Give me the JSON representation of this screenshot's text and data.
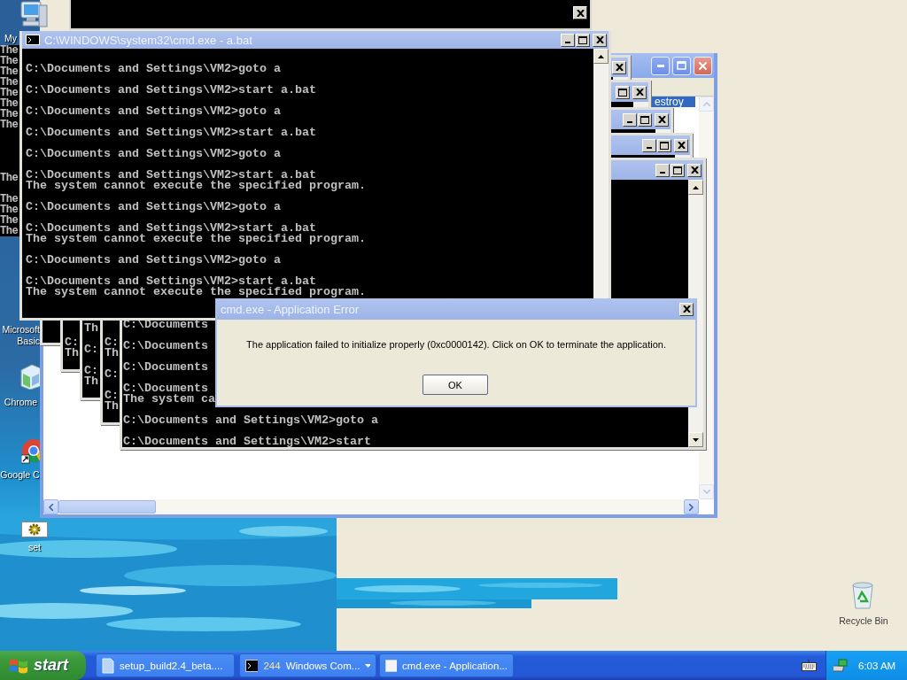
{
  "desktop_icons": [
    {
      "kind": "computer",
      "label": [
        "My"
      ]
    },
    {
      "kind": "hidden",
      "label": [
        "Microsoft",
        "Basic"
      ]
    },
    {
      "kind": "app",
      "label": [
        "Chrome"
      ]
    },
    {
      "kind": "browser",
      "label": [
        "Google C"
      ]
    },
    {
      "kind": "settings",
      "label": [
        "set"
      ]
    },
    {
      "kind": "recycle",
      "label": [
        "Recycle Bin"
      ]
    }
  ],
  "background_window": {
    "selected_item": "estroy"
  },
  "cascade_windows": [
    {
      "lines": [
        {
          "kind": "text",
          "text": "C:"
        },
        {
          "kind": "text",
          "text": "Th"
        },
        {
          "kind": "blank"
        }
      ]
    },
    {
      "lines": [
        {
          "kind": "text",
          "text": "Th"
        },
        {
          "kind": "blank"
        },
        {
          "kind": "text",
          "text": "C:"
        },
        {
          "kind": "blank"
        },
        {
          "kind": "text",
          "text": "C:"
        },
        {
          "kind": "text",
          "text": "Th"
        },
        {
          "kind": "blank"
        }
      ]
    },
    {
      "lines": [
        {
          "kind": "text",
          "text": "C:"
        },
        {
          "kind": "text",
          "text": "Th"
        },
        {
          "kind": "blank"
        },
        {
          "kind": "text",
          "text": "C:"
        },
        {
          "kind": "blank"
        },
        {
          "kind": "text",
          "text": "C:"
        },
        {
          "kind": "text",
          "text": "Th"
        },
        {
          "kind": "blank"
        }
      ]
    },
    {
      "lines": [
        {
          "kind": "text",
          "text": "C:\\Documents"
        },
        {
          "kind": "blank"
        },
        {
          "kind": "text",
          "text": "C:\\Documents"
        },
        {
          "kind": "blank"
        },
        {
          "kind": "text",
          "text": "C:\\Documents"
        },
        {
          "kind": "blank"
        },
        {
          "kind": "text",
          "text": "C:\\Documents"
        },
        {
          "kind": "text",
          "text": "The system ca"
        },
        {
          "kind": "blank"
        },
        {
          "kind": "text",
          "text": "C:\\Documents and Settings\\VM2>goto a"
        },
        {
          "kind": "blank"
        },
        {
          "kind": "text",
          "text": "C:\\Documents and Settings\\VM2>start"
        }
      ]
    }
  ],
  "left_console": {
    "lines": [
      {
        "kind": "text",
        "text": "The"
      },
      {
        "kind": "text",
        "text": "The"
      },
      {
        "kind": "text",
        "text": "The"
      },
      {
        "kind": "text",
        "text": "The"
      },
      {
        "kind": "text",
        "text": "The"
      },
      {
        "kind": "text",
        "text": "The"
      },
      {
        "kind": "text",
        "text": "The"
      },
      {
        "kind": "text",
        "text": "The"
      },
      {
        "kind": "blank"
      },
      {
        "kind": "blank"
      },
      {
        "kind": "blank"
      },
      {
        "kind": "blank"
      },
      {
        "kind": "text",
        "text": "The"
      },
      {
        "kind": "blank"
      },
      {
        "kind": "text",
        "text": "The"
      },
      {
        "kind": "text",
        "text": "The"
      },
      {
        "kind": "text",
        "text": "The"
      },
      {
        "kind": "text",
        "text": "The"
      }
    ]
  },
  "main_console": {
    "title": "C:\\WINDOWS\\system32\\cmd.exe - a.bat",
    "lines": [
      {
        "kind": "blank"
      },
      {
        "kind": "text",
        "text": "C:\\Documents and Settings\\VM2>goto a"
      },
      {
        "kind": "blank"
      },
      {
        "kind": "text",
        "text": "C:\\Documents and Settings\\VM2>start a.bat"
      },
      {
        "kind": "blank"
      },
      {
        "kind": "text",
        "text": "C:\\Documents and Settings\\VM2>goto a"
      },
      {
        "kind": "blank"
      },
      {
        "kind": "text",
        "text": "C:\\Documents and Settings\\VM2>start a.bat"
      },
      {
        "kind": "blank"
      },
      {
        "kind": "text",
        "text": "C:\\Documents and Settings\\VM2>goto a"
      },
      {
        "kind": "blank"
      },
      {
        "kind": "text",
        "text": "C:\\Documents and Settings\\VM2>start a.bat"
      },
      {
        "kind": "text",
        "text": "The system cannot execute the specified program."
      },
      {
        "kind": "blank"
      },
      {
        "kind": "text",
        "text": "C:\\Documents and Settings\\VM2>goto a"
      },
      {
        "kind": "blank"
      },
      {
        "kind": "text",
        "text": "C:\\Documents and Settings\\VM2>start a.bat"
      },
      {
        "kind": "text",
        "text": "The system cannot execute the specified program."
      },
      {
        "kind": "blank"
      },
      {
        "kind": "text",
        "text": "C:\\Documents and Settings\\VM2>goto a"
      },
      {
        "kind": "blank"
      },
      {
        "kind": "text",
        "text": "C:\\Documents and Settings\\VM2>start a.bat"
      },
      {
        "kind": "text",
        "text": "The system cannot execute the specified program."
      }
    ]
  },
  "dialog": {
    "title": "cmd.exe - Application Error",
    "message": "The application failed to initialize properly (0xc0000142). Click on OK to terminate the application.",
    "buttons": [
      "OK"
    ]
  },
  "taskbar": {
    "start": "start",
    "tasks": [
      {
        "kind": "installer",
        "label": "setup_build2.4_beta...."
      },
      {
        "kind": "console_group",
        "count": "244",
        "label": "Windows Com..."
      },
      {
        "kind": "dialog",
        "label": "cmd.exe - Application..."
      }
    ],
    "clock": "6:03 AM"
  }
}
